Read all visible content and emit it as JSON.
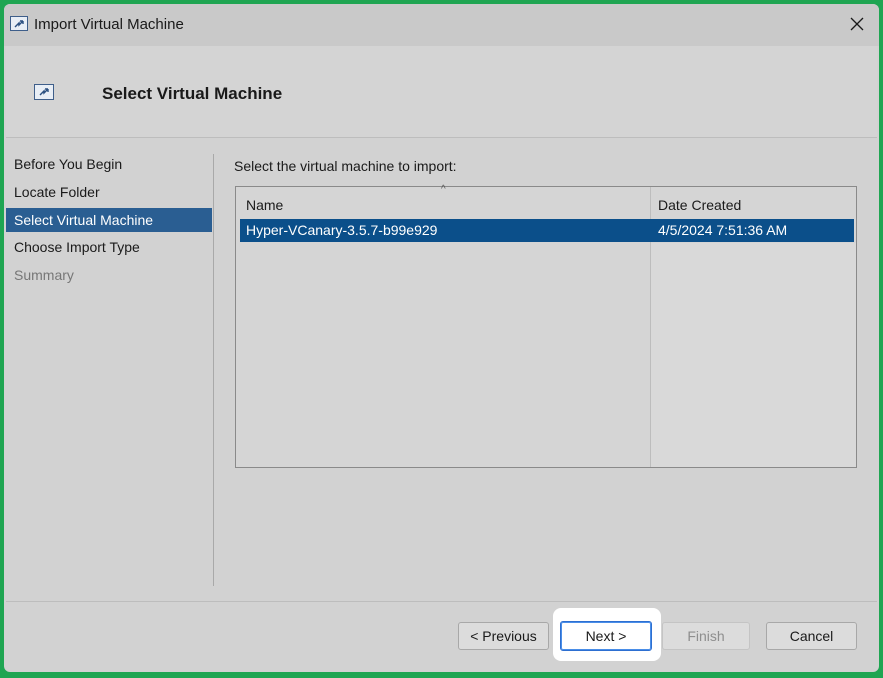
{
  "window": {
    "title": "Import Virtual Machine",
    "close_glyph": "✕"
  },
  "header": {
    "title": "Select Virtual Machine"
  },
  "nav": {
    "items": [
      {
        "label": "Before You Begin",
        "state": "normal"
      },
      {
        "label": "Locate Folder",
        "state": "normal"
      },
      {
        "label": "Select Virtual Machine",
        "state": "selected"
      },
      {
        "label": "Choose Import Type",
        "state": "normal"
      },
      {
        "label": "Summary",
        "state": "disabled"
      }
    ]
  },
  "main": {
    "prompt": "Select the virtual machine to import:",
    "list": {
      "columns": [
        "Name",
        "Date Created"
      ],
      "sort_indicator": "^",
      "rows": [
        {
          "name": "Hyper-VCanary-3.5.7-b99e929",
          "date_created": "4/5/2024 7:51:36 AM"
        }
      ]
    }
  },
  "footer": {
    "previous_label": "< Previous",
    "next_label": "Next >",
    "finish_label": "Finish",
    "cancel_label": "Cancel"
  },
  "colors": {
    "selection": "#0b4f8a",
    "nav_selection": "#2a5e92",
    "frame_border": "#1fa552",
    "highlight": "#ffffff"
  },
  "icons": {
    "app": "import-vm-icon",
    "header": "import-vm-icon",
    "close": "close-icon"
  }
}
